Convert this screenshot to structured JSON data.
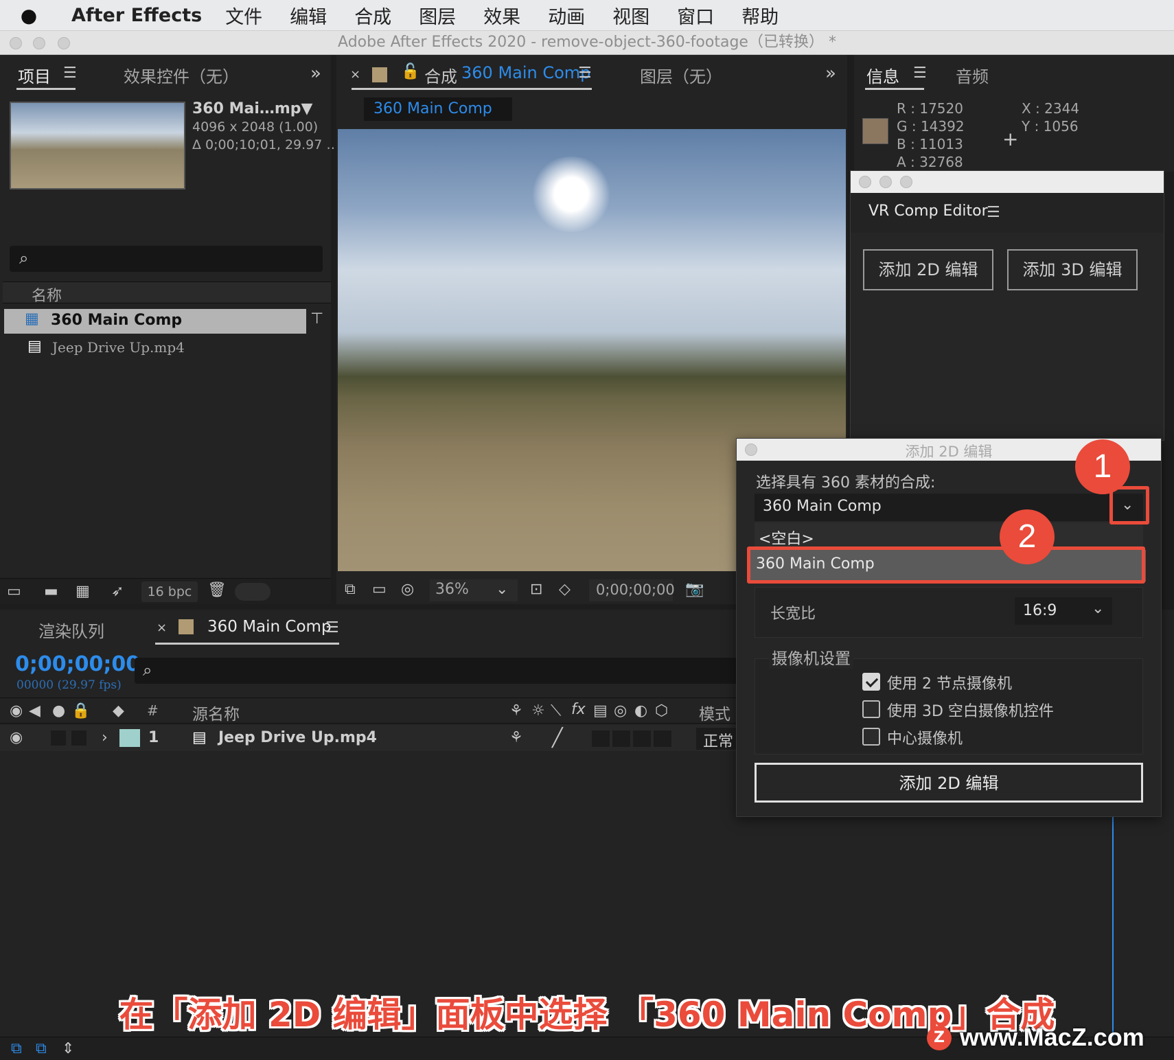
{
  "menubar": {
    "app": "After Effects",
    "items": [
      "文件",
      "编辑",
      "合成",
      "图层",
      "效果",
      "动画",
      "视图",
      "窗口",
      "帮助"
    ]
  },
  "window": {
    "title": "Adobe After Effects 2020 - remove-object-360-footage（已转换） *"
  },
  "project_panel": {
    "tab_project": "项目",
    "tab_effects": "效果控件（无）",
    "footage_name": "360 Mai…mp▼",
    "footage_size": "4096 x 2048 (1.00)",
    "footage_duration": "Δ 0;00;10;01, 29.97 …",
    "col_name": "名称",
    "items": [
      {
        "label": "360 Main Comp"
      },
      {
        "label": "Jeep Drive Up.mp4"
      }
    ],
    "bpc": "16 bpc"
  },
  "comp_panel": {
    "tab_prefix": "合成",
    "tab_comp": "360 Main Comp",
    "tab_layer": "图层（无）",
    "breadcrumb": "360 Main Comp",
    "zoom": "36%",
    "timecode": "0;00;00;00"
  },
  "info_panel": {
    "tab_info": "信息",
    "tab_audio": "音频",
    "r": "R :  17520",
    "g": "G :  14392",
    "b": "B :  11013",
    "a": "A :  32768",
    "x": "X :  2344",
    "y": "Y :  1056",
    "swatch": "#8b7660"
  },
  "vr_panel": {
    "title": "VR Comp Editor",
    "btn_2d": "添加 2D 编辑",
    "btn_3d": "添加 3D 编辑"
  },
  "timeline": {
    "tab_render": "渲染队列",
    "tab_comp": "360 Main Comp",
    "timecode": "0;00;00;00",
    "fps": "00000 (29.97 fps)",
    "col_hash": "#",
    "col_source": "源名称",
    "col_mode": "模式",
    "layer_num": "1",
    "layer_name": "Jeep Drive Up.mp4",
    "layer_mode": "正常"
  },
  "dialog": {
    "title": "添加 2D 编辑",
    "label": "选择具有 360 素材的合成:",
    "selected": "360 Main Comp",
    "options": [
      "<空白>",
      "360 Main Comp"
    ],
    "aspect_label": "长宽比",
    "aspect_value": "16:9",
    "camera_group": "摄像机设置",
    "cb1": "使用 2 节点摄像机",
    "cb2": "使用 3D 空白摄像机控件",
    "cb3": "中心摄像机",
    "submit": "添加 2D 编辑"
  },
  "annotations": {
    "step1": "1",
    "step2": "2",
    "caption": "在「添加 2D 编辑」面板中选择 「360 Main Comp」合成",
    "watermark": "www.MacZ.com"
  },
  "colors": {
    "accent": "#2d8ceb",
    "annotation": "#ea4b3b"
  }
}
